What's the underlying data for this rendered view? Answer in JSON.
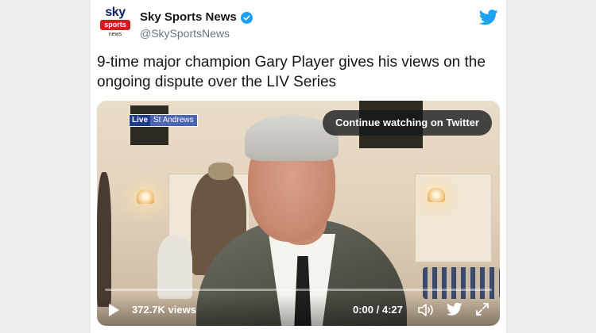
{
  "tweet": {
    "avatar": {
      "line1": "sky",
      "line2": "sports",
      "line3": "news"
    },
    "display_name": "Sky Sports News",
    "handle": "@SkySportsNews",
    "text": "9-time major champion Gary Player gives his views on the ongoing dispute over the LIV Series"
  },
  "video": {
    "live_label": "Live",
    "live_location": "St Andrews",
    "continue_label": "Continue watching on Twitter",
    "views": "372.7K views",
    "time": "0:00 / 4:27",
    "progress_fraction": 0.0
  },
  "colors": {
    "twitter_blue": "#1da1f2",
    "sky_red": "#d71920",
    "sky_navy": "#0a1f6b"
  },
  "icons": [
    "verified-badge-icon",
    "twitter-bird-icon",
    "play-icon",
    "volume-icon",
    "twitter-control-icon",
    "fullscreen-icon"
  ]
}
